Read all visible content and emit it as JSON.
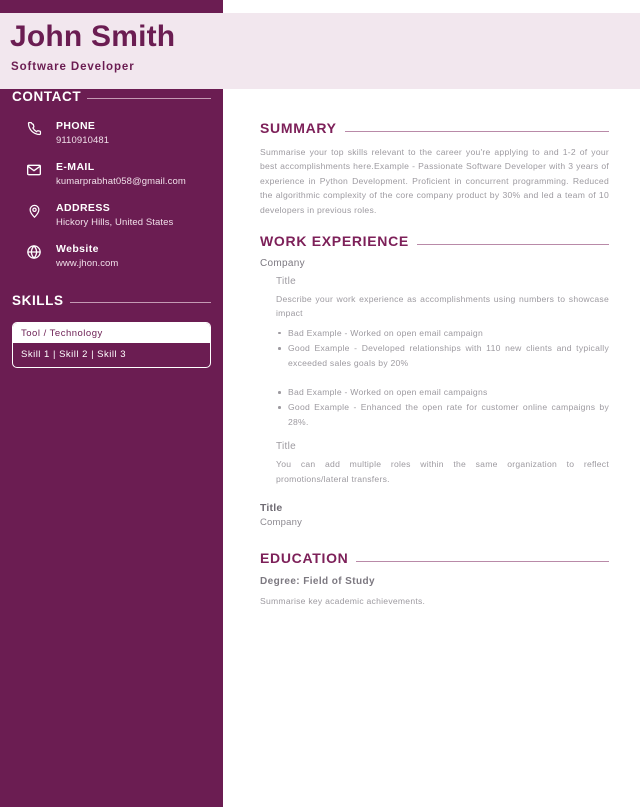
{
  "header": {
    "name": "John Smith",
    "job_title": "Software  Developer",
    "band_color": "#f2e7ee",
    "accent_color": "#6b1d52"
  },
  "sidebar": {
    "contact": {
      "heading": "CONTACT",
      "items": [
        {
          "icon": "phone-icon",
          "label": "PHONE",
          "value": "9110910481"
        },
        {
          "icon": "envelope-icon",
          "label": "E-MAIL",
          "value": "kumarprabhat058@gmail.com"
        },
        {
          "icon": "map-pin-icon",
          "label": "ADDRESS",
          "value": "Hickory  Hills,  United  States"
        },
        {
          "icon": "globe-icon",
          "label": "Website",
          "value": "www.jhon.com"
        }
      ]
    },
    "skills": {
      "heading": "SKILLS",
      "box_header": "Tool  /  Technology",
      "box_body": "Skill  1  |  Skill  2  |  Skill  3"
    }
  },
  "main": {
    "summary": {
      "heading": "SUMMARY",
      "body": "Summarise your top skills relevant to the career you're applying to and 1-2 of your best accomplishments here.Example - Passionate Software Developer with 3 years of experience in Python Development. Proficient in concurrent programming. Reduced the algorithmic complexity of the core company product by 30% and led a team of 10 developers in previous roles."
    },
    "work_experience": {
      "heading": "WORK  EXPERIENCE",
      "company": "Company",
      "role_1": {
        "title": "Title",
        "description": "Describe your work experience as accomplishments using numbers to showcase impact",
        "bullets_group_1": [
          "Bad Example - Worked on open email campaign",
          "Good Example - Developed relationships with 110 new clients and typically exceeded sales goals by 20%"
        ],
        "bullets_group_2": [
          "Bad Example - Worked on open email campaigns",
          "Good Example - Enhanced the open rate for customer online campaigns by 28%."
        ]
      },
      "role_2": {
        "title": "Title",
        "description": "You can add multiple roles within the same organization to reflect promotions/lateral transfers."
      },
      "entry_2": {
        "title": "Title",
        "company": "Company"
      }
    },
    "education": {
      "heading": "EDUCATION",
      "degree": "Degree:  Field  of  Study",
      "description": "Summarise key academic achievements."
    }
  }
}
